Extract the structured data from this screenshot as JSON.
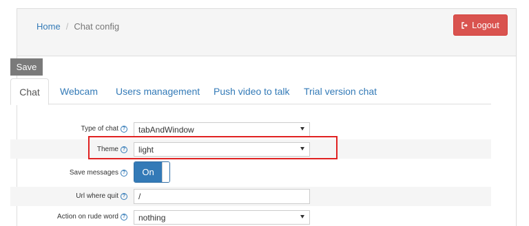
{
  "breadcrumb": {
    "home": "Home",
    "separator": "/",
    "current": "Chat config"
  },
  "header": {
    "logout_label": "Logout"
  },
  "toolbar": {
    "save_label": "Save"
  },
  "tabs": [
    {
      "label": "Chat",
      "active": true
    },
    {
      "label": "Webcam",
      "active": false
    },
    {
      "label": "Users management",
      "active": false
    },
    {
      "label": "Push video to talk",
      "active": false
    },
    {
      "label": "Trial version chat",
      "active": false
    }
  ],
  "form": {
    "type_of_chat": {
      "label": "Type of chat",
      "value": "tabAndWindow"
    },
    "theme": {
      "label": "Theme",
      "value": "light"
    },
    "save_messages": {
      "label": "Save messages",
      "value": "On"
    },
    "url_where_quit": {
      "label": "Url where quit",
      "value": "/"
    },
    "action_on_rude_word": {
      "label": "Action on rude word",
      "value": "nothing"
    }
  },
  "help_glyph": "?",
  "colors": {
    "logout_bg": "#d9534f",
    "primary": "#337ab7",
    "highlight": "#e02020",
    "save_bg": "#7a7a7a"
  }
}
